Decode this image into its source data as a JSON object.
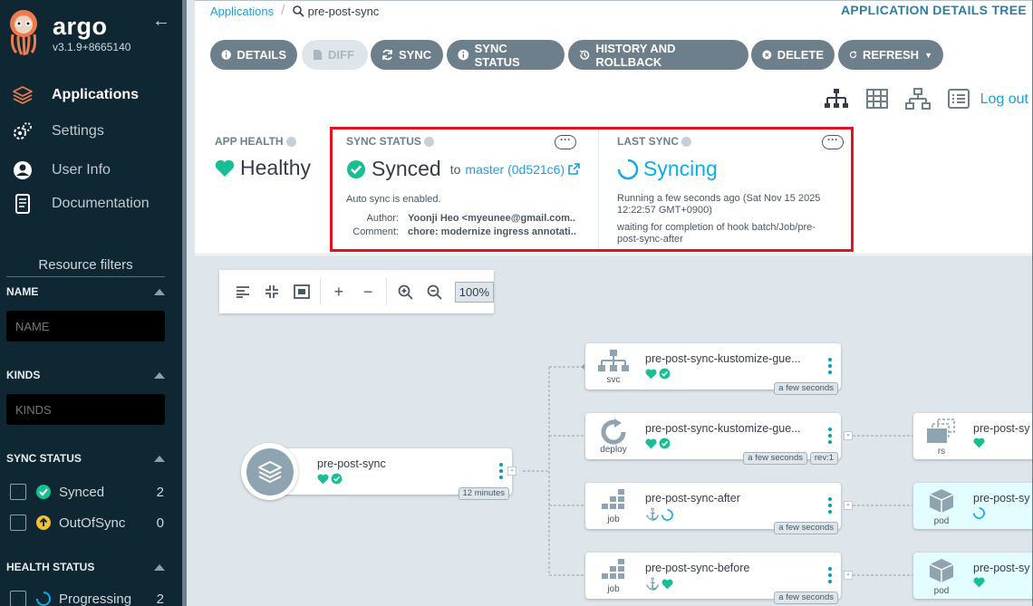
{
  "sidebar": {
    "brand": "argo",
    "version": "v3.1.9+8665140",
    "nav": [
      {
        "label": "Applications",
        "icon": "layers-icon",
        "active": true
      },
      {
        "label": "Settings",
        "icon": "gears-icon",
        "active": false
      },
      {
        "label": "User Info",
        "icon": "user-icon",
        "active": false
      },
      {
        "label": "Documentation",
        "icon": "book-icon",
        "active": false
      }
    ],
    "resource_filters": "Resource filters",
    "name_label": "NAME",
    "name_placeholder": "NAME",
    "kinds_label": "KINDS",
    "kinds_placeholder": "KINDS",
    "sync_status_label": "SYNC STATUS",
    "sync_items": [
      {
        "label": "Synced",
        "count": "2"
      },
      {
        "label": "OutOfSync",
        "count": "0"
      }
    ],
    "health_status_label": "HEALTH STATUS",
    "health_items": [
      {
        "label": "Progressing",
        "count": "2"
      }
    ]
  },
  "header": {
    "breadcrumb_root": "Applications",
    "breadcrumb_current": "pre-post-sync",
    "view_title": "APPLICATION DETAILS TREE",
    "logout": "Log out"
  },
  "toolbar": {
    "details": "DETAILS",
    "diff": "DIFF",
    "sync": "SYNC",
    "sync_status": "SYNC STATUS",
    "history": "HISTORY AND ROLLBACK",
    "delete": "DELETE",
    "refresh": "REFRESH"
  },
  "status": {
    "app_health_label": "APP HEALTH",
    "app_health_value": "Healthy",
    "sync_status_label": "SYNC STATUS",
    "sync_value": "Synced",
    "sync_to": "to",
    "sync_revision": "master (0d521c6)",
    "auto_sync": "Auto sync is enabled.",
    "author_label": "Author:",
    "author_value": "Yoonji Heo <myeunee@gmail.com...",
    "comment_label": "Comment:",
    "comment_value": "chore: modernize ingress annotati...",
    "last_sync_label": "LAST SYNC",
    "last_sync_value": "Syncing",
    "last_sync_running": "Running a few seconds ago (Sat Nov 15 2025 12:22:57 GMT+0900)",
    "last_sync_waiting": "waiting for completion of hook batch/Job/pre-post-sync-after"
  },
  "canvas": {
    "zoom": "100%",
    "root": {
      "name": "pre-post-sync",
      "age": "12 minutes"
    },
    "nodes": [
      {
        "name": "pre-post-sync-kustomize-gue...",
        "kind": "svc",
        "age": "a few seconds"
      },
      {
        "name": "pre-post-sync-kustomize-gue...",
        "kind": "deploy",
        "age": "a few seconds",
        "rev": "rev:1"
      },
      {
        "name": "pre-post-sync-after",
        "kind": "job",
        "age": "a few seconds"
      },
      {
        "name": "pre-post-sync-before",
        "kind": "job",
        "age": "a few seconds"
      }
    ],
    "children": [
      {
        "name": "pre-post-sy",
        "kind": "rs"
      },
      {
        "name": "pre-post-sy",
        "kind": "pod"
      },
      {
        "name": "pre-post-sy",
        "kind": "pod"
      }
    ]
  },
  "colors": {
    "healthy": "#18be94",
    "progressing": "#0dadea",
    "sidebar": "#0f2733",
    "highlight": "#e0131f"
  }
}
